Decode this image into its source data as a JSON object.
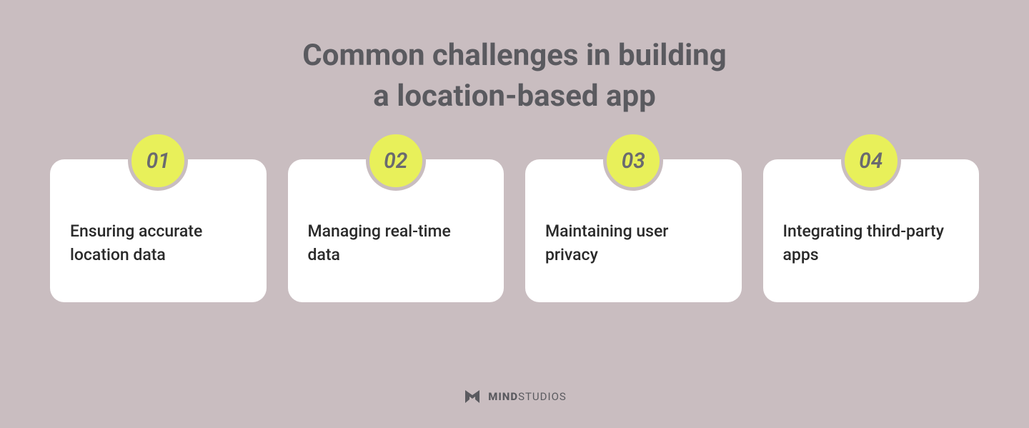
{
  "title_line1": "Common challenges in building",
  "title_line2": "a location-based app",
  "cards": [
    {
      "number": "01",
      "text": "Ensuring accurate location data"
    },
    {
      "number": "02",
      "text": "Managing real-time data"
    },
    {
      "number": "03",
      "text": "Maintaining user privacy"
    },
    {
      "number": "04",
      "text": "Integrating third-party apps"
    }
  ],
  "footer": {
    "brand_bold": "MIND",
    "brand_light": "STUDIOS"
  }
}
